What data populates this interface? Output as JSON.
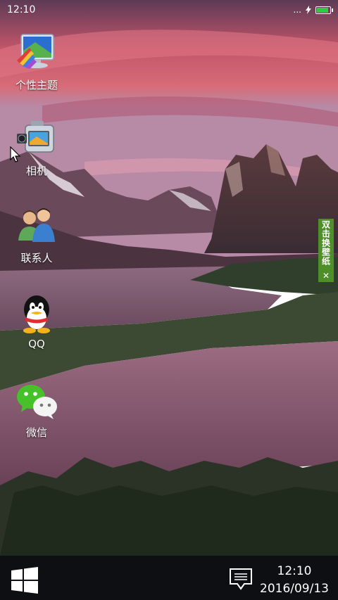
{
  "status": {
    "time": "12:10",
    "dots": "...",
    "battery_level": 0.95
  },
  "apps": [
    {
      "label": "个性主题",
      "icon": "theme-icon"
    },
    {
      "label": "相机",
      "icon": "camera-icon"
    },
    {
      "label": "联系人",
      "icon": "contacts-icon"
    },
    {
      "label": "QQ",
      "icon": "qq-icon"
    },
    {
      "label": "微信",
      "icon": "wechat-icon"
    }
  ],
  "side_tab": {
    "text": "双击换壁纸",
    "close": "✕"
  },
  "taskbar": {
    "time": "12:10",
    "date": "2016/09/13"
  },
  "colors": {
    "taskbar_bg": "#0d0f12",
    "side_tab_bg": "#4e8f2a"
  }
}
